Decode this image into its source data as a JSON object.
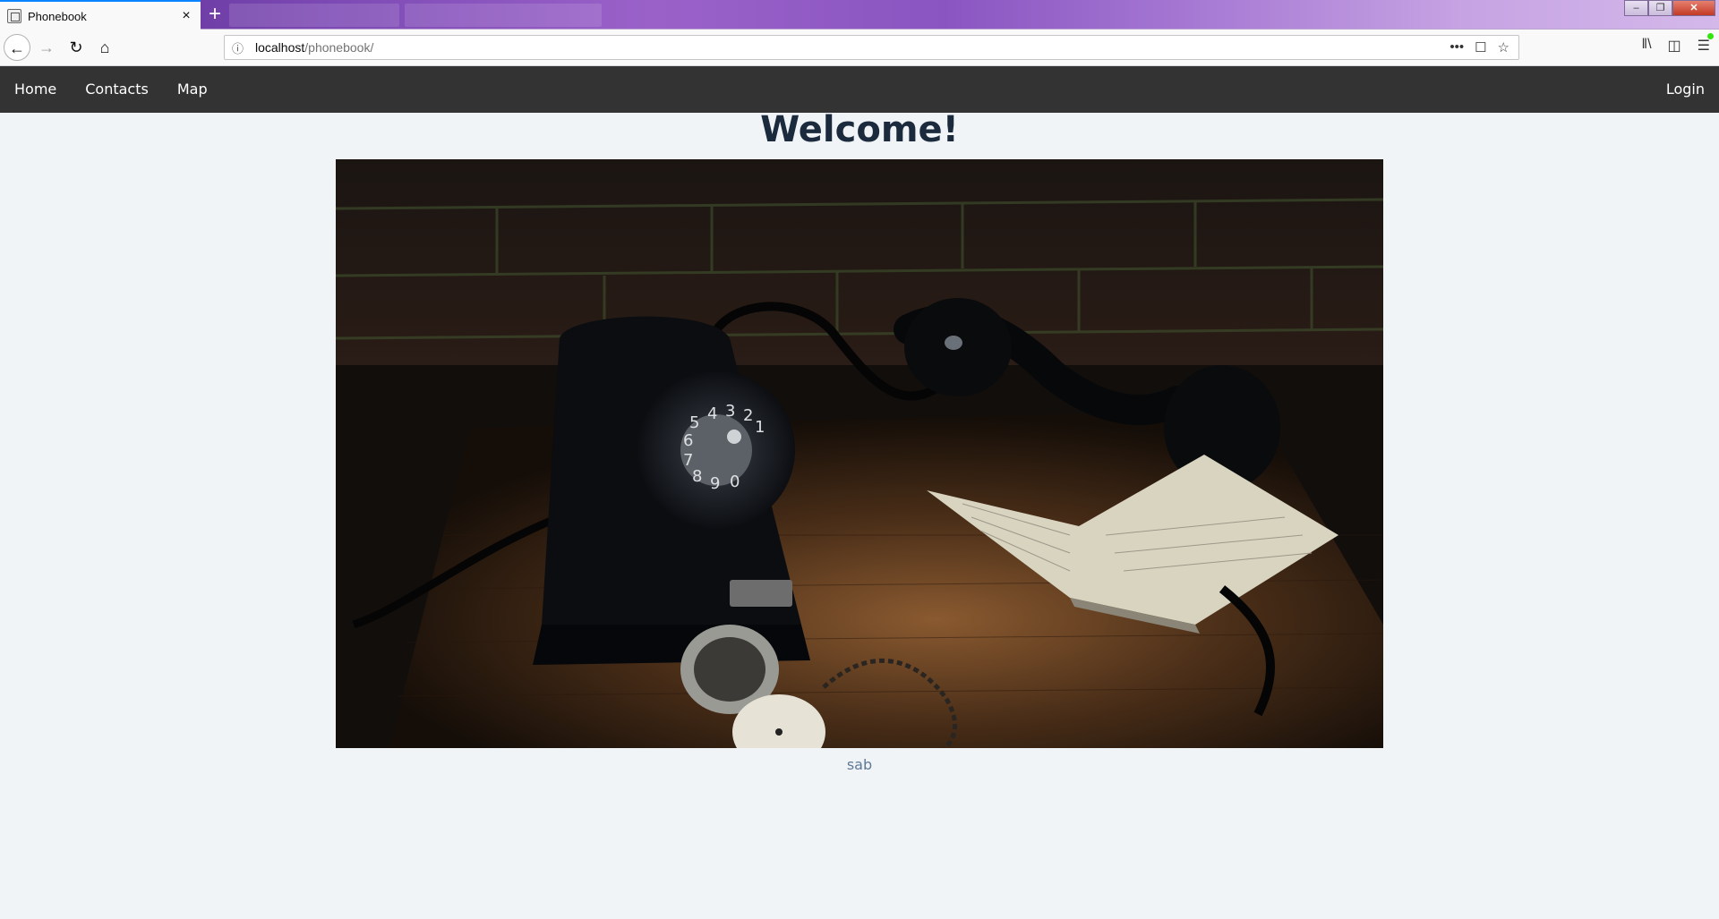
{
  "browser": {
    "tab": {
      "title": "Phonebook",
      "close": "×"
    },
    "new_tab": "+",
    "url_host": "localhost",
    "url_path": "/phonebook/",
    "url_actions": [
      "•••",
      "☐",
      "☆"
    ],
    "window_controls": [
      "–",
      "❐",
      "✕"
    ]
  },
  "nav": {
    "links": [
      "Home",
      "Contacts",
      "Map"
    ],
    "login": "Login"
  },
  "main": {
    "heading": "Welcome!",
    "caption": "sab"
  }
}
